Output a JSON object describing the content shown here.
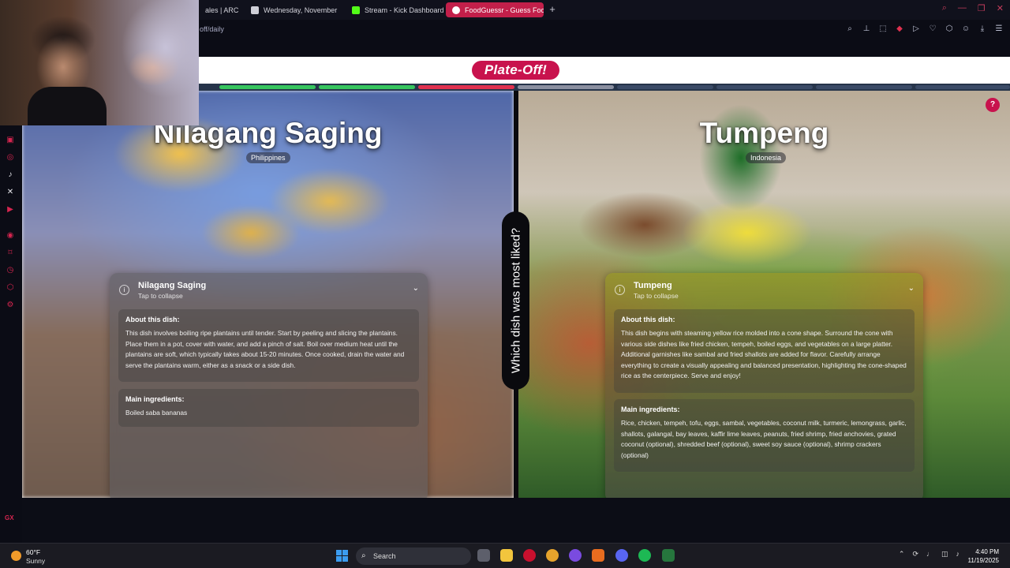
{
  "browser": {
    "tabs": [
      {
        "label": "ales | ARC R",
        "active": false
      },
      {
        "label": "Wednesday, November",
        "active": false
      },
      {
        "label": "Stream - Kick Dashboard",
        "active": false
      },
      {
        "label": "FoodGuessr - Guess Foo",
        "active": true
      }
    ],
    "new_tab": "+",
    "url": "off/daily"
  },
  "sidebar": {
    "badge": "GX"
  },
  "game": {
    "logo": "Plate-Off!",
    "help": "?",
    "question": "Which dish was most liked?",
    "progress_colors": {
      "green": "#36c55e",
      "red": "#e0314f",
      "neutral": "#8a8fa0"
    },
    "left": {
      "title": "Nilagang Saging",
      "country": "Philippines",
      "card": {
        "name": "Nilagang Saging",
        "subtitle": "Tap to collapse",
        "about_title": "About this dish:",
        "about": "This dish involves boiling ripe plantains until tender. Start by peeling and slicing the plantains. Place them in a pot, cover with water, and add a pinch of salt. Boil over medium heat until the plantains are soft, which typically takes about 15-20 minutes. Once cooked, drain the water and serve the plantains warm, either as a snack or a side dish.",
        "ingredients_title": "Main ingredients:",
        "ingredients": "Boiled saba bananas"
      }
    },
    "right": {
      "title": "Tumpeng",
      "country": "Indonesia",
      "card": {
        "name": "Tumpeng",
        "subtitle": "Tap to collapse",
        "about_title": "About this dish:",
        "about": "This dish begins with steaming yellow rice molded into a cone shape. Surround the cone with various side dishes like fried chicken, tempeh, boiled eggs, and vegetables on a large platter. Additional garnishes like sambal and fried shallots are added for flavor. Carefully arrange everything to create a visually appealing and balanced presentation, highlighting the cone-shaped rice as the centerpiece. Serve and enjoy!",
        "ingredients_title": "Main ingredients:",
        "ingredients": "Rice, chicken, tempeh, tofu, eggs, sambal, vegetables, coconut milk, turmeric, lemongrass, garlic, shallots, galangal, bay leaves, kaffir lime leaves, peanuts, fried shrimp, fried anchovies, grated coconut (optional), shredded beef (optional), sweet soy sauce (optional), shrimp crackers (optional)"
      }
    }
  },
  "taskbar": {
    "weather_temp": "60°F",
    "weather_cond": "Sunny",
    "search_placeholder": "Search",
    "time": "4:40 PM",
    "date": "11/19/2025"
  }
}
